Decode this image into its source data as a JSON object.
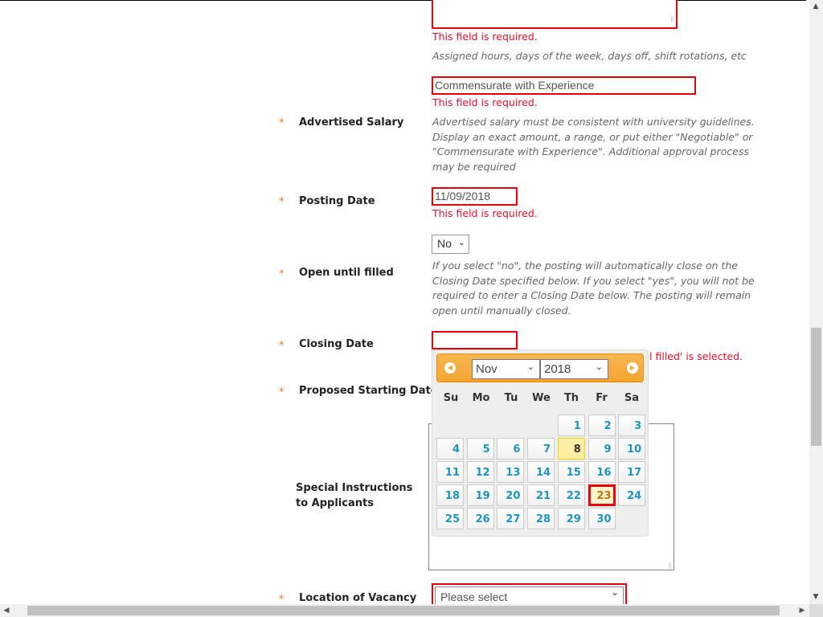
{
  "errors": {
    "required": "This field is required.",
    "closing_partial": "l filled' is selected."
  },
  "schedule": {
    "hint": "Assigned hours, days of the week, days off, shift rotations, etc"
  },
  "salary": {
    "label": "Advertised Salary",
    "value": "Commensurate with Experience",
    "hint": "Advertised salary must be consistent with university guidelines. Display an exact amount, a range, or put either \"Negotiable\" or \"Commensurate with Experience\". Additional approval process may be required"
  },
  "posting": {
    "label": "Posting Date",
    "value": "11/09/2018"
  },
  "open_until_filled": {
    "label": "Open until filled",
    "value": "No",
    "hint": "If you select \"no\", the posting will automatically close on the Closing Date specified below. If you select \"yes\", you will not be required to enter a Closing Date below. The posting will remain open until manually closed."
  },
  "closing": {
    "label": "Closing Date",
    "value": ""
  },
  "starting": {
    "label": "Proposed Starting Date"
  },
  "special": {
    "label": "Special Instructions to Applicants"
  },
  "location": {
    "label": "Location of Vacancy",
    "value": "Please select"
  },
  "calendar": {
    "month": "Nov",
    "year": "2018",
    "prev_icon": "circle-triangle-w",
    "next_icon": "circle-triangle-e",
    "weekdays": [
      "Su",
      "Mo",
      "Tu",
      "We",
      "Th",
      "Fr",
      "Sa"
    ],
    "first_weekday_index": 4,
    "days_in_month": 30,
    "today": 8,
    "selected": 23
  },
  "colors": {
    "error": "#e8102a",
    "accent": "#f6a828",
    "day_text": "#1c94c4"
  }
}
